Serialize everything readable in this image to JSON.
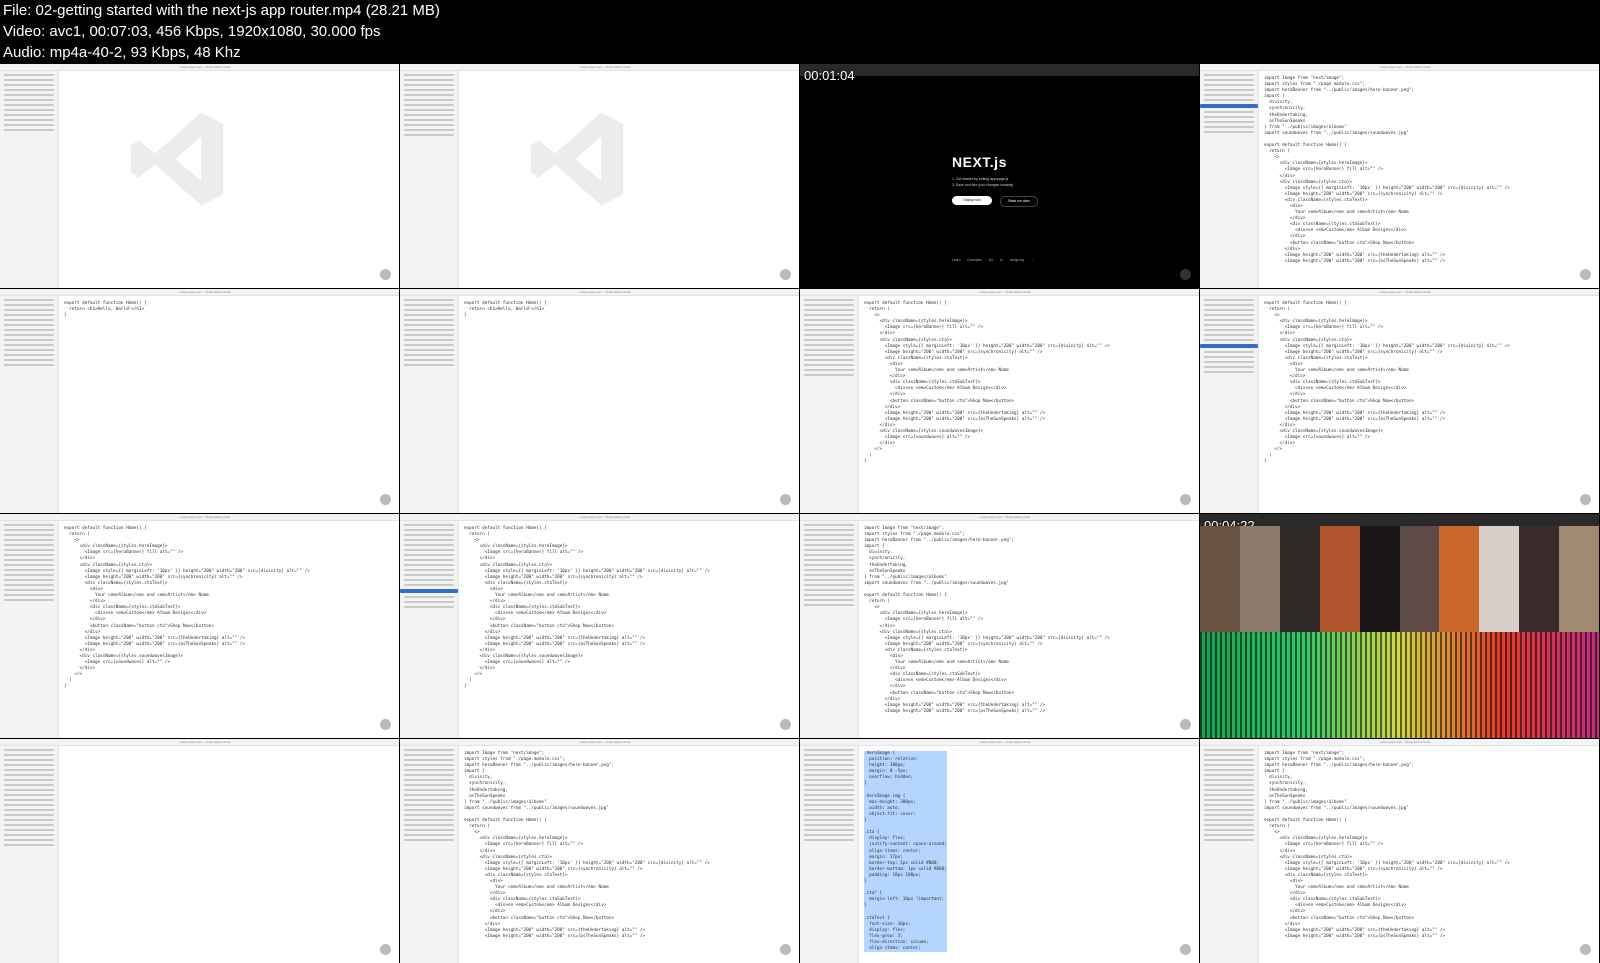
{
  "header": {
    "file_line": "File: 02-getting started with the next-js app router.mp4 (28.21 MB)",
    "video_line": "Video: avc1, 00:07:03, 456 Kbps, 1920x1080, 30.000 fps",
    "audio_line": "Audio: mp4a-40-2, 93 Kbps, 48 Khz"
  },
  "frames": {
    "t1": "00:01:04",
    "t2": "00:04:22"
  },
  "window_title": "nextjs-app-router - Visual Studio Code",
  "next_page": {
    "logo": "NEXT.js",
    "steps": [
      "1. Get started by editing app/page.js",
      "2. Save and see your changes instantly."
    ],
    "deploy": "Deploy now",
    "docs": "Read our docs",
    "footer": "Learn  Examples  Go to nextjs.org →"
  },
  "code": {
    "hello": "export default function Home() {\n  return <h1>Hello, World!</h1>\n}",
    "home": "export default function Home() {\n  return (\n    <>\n      <div className={styles.heroImage}>\n        <Image src={heroBanner} fill alt=\"\" />\n      </div>\n      <div className={styles.cta}>\n        <Image style={{ marginLeft: '10px' }} height=\"200\" width=\"200\" src={divinity} alt=\"\" />\n        <Image height=\"200\" width=\"200\" src={synchronicity} alt=\"\" />\n        <div className={styles.ctaText}>\n          <div>\n            Your <em>Album</em> and <em>Artist</em> Name\n          </div>\n          <div className={styles.ctaSubText}>\n            <div>on <em>Custom</em> Album Designs</div>\n          </div>\n          <button className=\"button cta\">Shop Now</button>\n        </div>\n        <Image height=\"200\" width=\"200\" src={theUndertaking} alt=\"\" />\n        <Image height=\"200\" width=\"200\" src={asTheSunSpeaks} alt=\"\" />\n      </div>\n      <div className={styles.soundwavesImage}>\n        <Image src={soundwaves} alt=\"\" />\n      </div>\n    </>\n  )\n}",
    "imports": "import Image from \"next/image\";\nimport styles from \"./page.module.css\";\nimport heroBanner from \"../public/images/hero-banner.png\";\nimport {\n  divinity,\n  synchronicity,\n  theUndertaking,\n  asTheSunSpeaks\n} from \"../public/images/albums\"\nimport soundwaves from \"../public/images/soundwaves.jpg\"\n\nexport default function Home() {\n  return (\n    <>\n      <div className={styles.heroImage}>\n        <Image src={heroBanner} fill alt=\"\" />\n      </div>\n      <div className={styles.cta}>\n        <Image style={{ marginLeft: '10px' }} height=\"200\" width=\"200\" src={divinity} alt=\"\" />\n        <Image height=\"200\" width=\"200\" src={synchronicity} alt=\"\" />\n        <div className={styles.ctaText}>\n          <div>\n            Your <em>Album</em> and <em>Artist</em> Name\n          </div>\n          <div className={styles.ctaSubText}>\n            <div>on <em>Custom</em> Album Designs</div>\n          </div>\n          <button className=\"button cta\">Shop Now</button>\n        </div>\n        <Image height=\"200\" width=\"200\" src={theUndertaking} alt=\"\" />\n        <Image height=\"200\" width=\"200\" src={asTheSunSpeaks} alt=\"\" />",
    "css": ".heroImage {\n  position: relative;\n  height: 300px;\n  margin: 0 -5px;\n  overflow: hidden;\n}\n\n.heroImage img {\n  max-height: 300px;\n  width: auto;\n  object-fit: cover;\n}\n\n.cta {\n  display: flex;\n  justify-content: space-around;\n  align-items: center;\n  margin: 17px;\n  border-top: 1px solid #000;\n  border-bottom: 1px solid #000;\n  padding: 10px 100px;\n}\n\n.cta* {\n  margin-left: 10px !important;\n}\n\n.ctaText {\n  font-size: 30px;\n  display: flex;\n  flex-grow: 3;\n  flex-direction: column;\n  align-items: center;"
  },
  "colors": {
    "selection": "#2f6fc6",
    "background": "#000000",
    "vscode_light": "#ffffff"
  },
  "icons": [
    "vscode-logo-icon",
    "avatar-icon"
  ]
}
